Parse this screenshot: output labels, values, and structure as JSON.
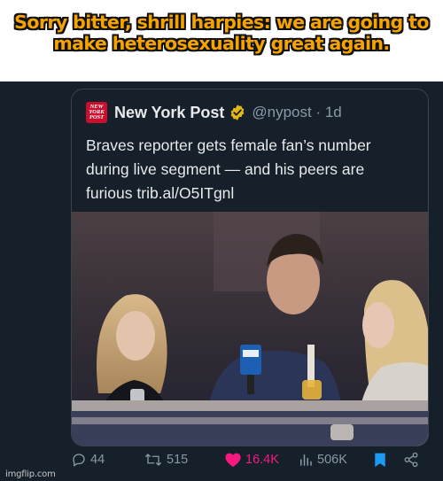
{
  "meme": {
    "caption_line1": "Sorry bitter, shrill harpies: we are going to",
    "caption_line2": "make heterosexuality great again.",
    "caption_color": "#f5a300"
  },
  "tweet": {
    "author_logo_text": [
      "NEW",
      "YORK",
      "POST"
    ],
    "author_name": "New York Post",
    "handle_time": "@nypost · 1d",
    "text_lines": [
      "Braves reporter gets female fan’s number",
      "during live segment — and his peers are",
      "furious trib.al/O5ITgnl"
    ],
    "verified_badge": "gold-verified-icon"
  },
  "actions": {
    "replies": "44",
    "reposts": "515",
    "likes": "16.4K",
    "views": "506K",
    "like_color": "#f91880",
    "bookmark_color": "#1d9bf0"
  },
  "watermark": "imgflip.com"
}
